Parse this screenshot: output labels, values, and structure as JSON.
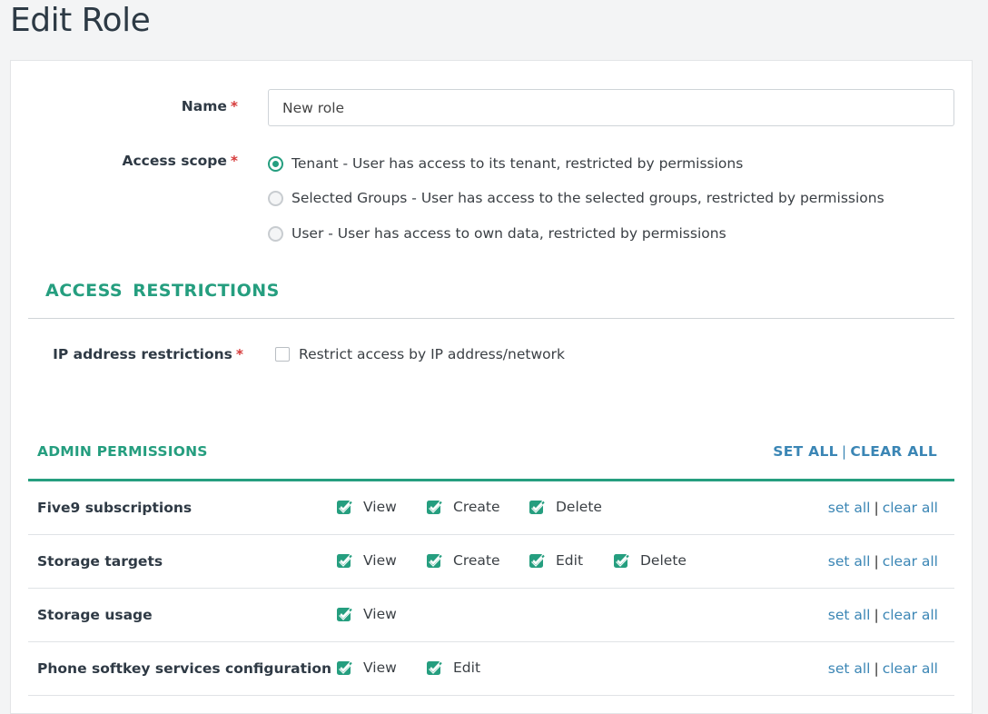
{
  "page": {
    "title": "Edit Role"
  },
  "form": {
    "name_label": "Name",
    "required_mark": "*",
    "name_value": "New role",
    "scope_label": "Access scope",
    "scope_options": [
      {
        "label": "Tenant - User has access to its tenant, restricted by permissions",
        "checked": true
      },
      {
        "label": "Selected Groups - User has access to the selected groups, restricted by permissions",
        "checked": false
      },
      {
        "label": "User - User has access to own data, restricted by permissions",
        "checked": false
      }
    ]
  },
  "access_restrictions": {
    "title": "ACCESS RESTRICTIONS",
    "ip_label": "IP address restrictions",
    "ip_checkbox_label": "Restrict access by IP address/network",
    "ip_checked": false
  },
  "admin_permissions": {
    "title": "ADMIN PERMISSIONS",
    "set_all": "SET ALL",
    "separator": "|",
    "clear_all": "CLEAR ALL",
    "row_set_all": "set all",
    "row_clear_all": "clear all",
    "rows": [
      {
        "name": "Five9 subscriptions",
        "options": [
          "View",
          "Create",
          "Delete"
        ]
      },
      {
        "name": "Storage targets",
        "options": [
          "View",
          "Create",
          "Edit",
          "Delete"
        ]
      },
      {
        "name": "Storage usage",
        "options": [
          "View"
        ]
      },
      {
        "name": "Phone softkey services configuration",
        "options": [
          "View",
          "Edit"
        ]
      }
    ]
  },
  "colors": {
    "accent": "#259e7f",
    "link": "#3b86b5",
    "required": "#d63a3a"
  }
}
